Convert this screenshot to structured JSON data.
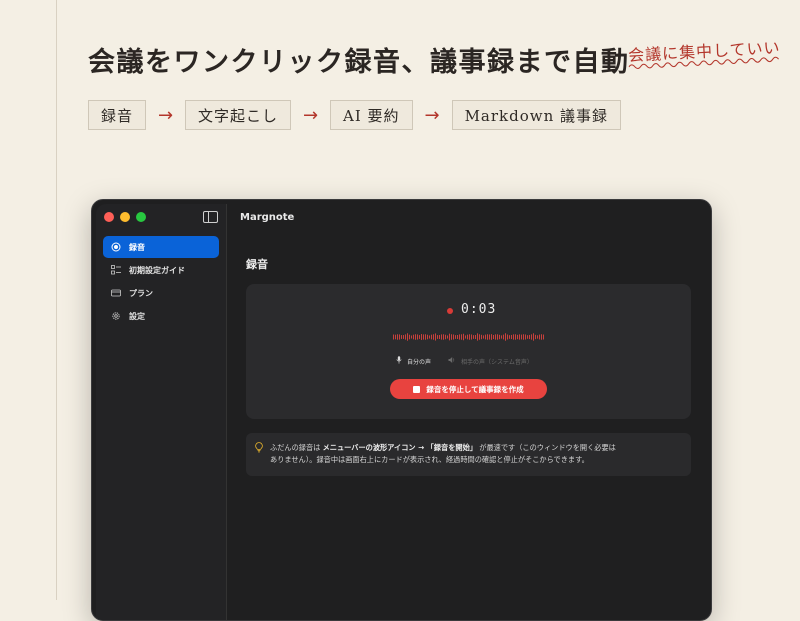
{
  "headline": "会議をワンクリック録音、議事録まで自動",
  "side_note": "会議に集中していい",
  "flow": {
    "steps": [
      "録音",
      "文字起こし",
      "AI 要約",
      "Markdown 議事録"
    ],
    "arrow": "→"
  },
  "app": {
    "title": "Margnote",
    "sidebar": {
      "items": [
        {
          "label": "録音",
          "icon": "record-icon",
          "active": true
        },
        {
          "label": "初期設定ガイド",
          "icon": "checklist-icon",
          "active": false
        },
        {
          "label": "プラン",
          "icon": "card-icon",
          "active": false
        },
        {
          "label": "設定",
          "icon": "gear-icon",
          "active": false
        }
      ]
    },
    "main": {
      "section_title": "録音",
      "recording": {
        "timer": "0:03",
        "sources": [
          {
            "label": "自分の声",
            "icon": "mic-icon",
            "enabled": true
          },
          {
            "label": "相手の声（システム音声）",
            "icon": "speaker-icon",
            "enabled": false
          }
        ],
        "stop_button": "録音を停止して議事録を作成"
      },
      "tip": {
        "text_1": "ふだんの録音は ",
        "bold_1": "メニューバーの波形アイコン → 「録音を開始」",
        "text_2": " が最速です（このウィンドウを開く必要は",
        "line_2": "ありません）。録音中は画面右上にカードが表示され、経過時間の確認と停止がそこからできます。"
      }
    }
  },
  "colors": {
    "page_bg": "#f4efe4",
    "accent_red": "#b3362b",
    "active_blue": "#0a63d8",
    "record_red": "#e8433f"
  }
}
